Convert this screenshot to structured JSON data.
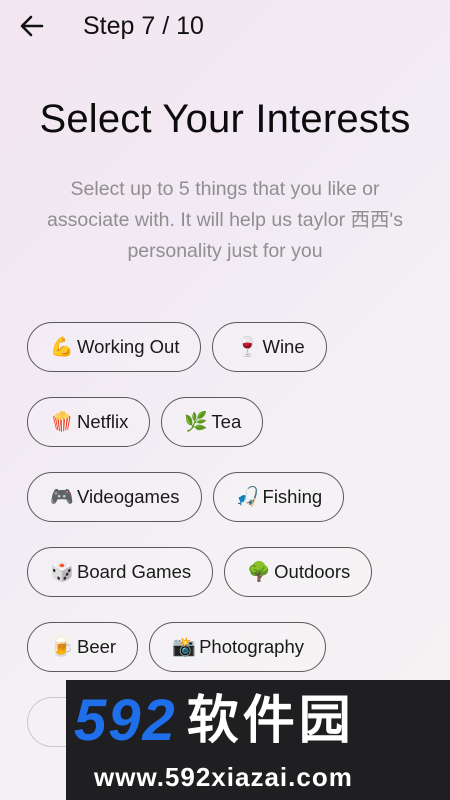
{
  "header": {
    "back_icon": "arrow-left-icon",
    "step": "Step 7 / 10"
  },
  "title": "Select Your Interests",
  "subtitle": "Select up to 5 things that you like or associate with. It will help us taylor 西西's personality just for you",
  "interests": [
    [
      {
        "emoji": "💪",
        "icon": "flexed-biceps-icon",
        "label": "Working Out"
      },
      {
        "emoji": "🍷",
        "icon": "wine-glass-icon",
        "label": "Wine"
      }
    ],
    [
      {
        "emoji": "🍿",
        "icon": "popcorn-icon",
        "label": "Netflix"
      },
      {
        "emoji": "🌿",
        "icon": "herb-leaf-icon",
        "label": "Tea"
      }
    ],
    [
      {
        "emoji": "🎮",
        "icon": "game-controller-icon",
        "label": "Videogames"
      },
      {
        "emoji": "🎣",
        "icon": "fishing-rod-icon",
        "label": "Fishing"
      }
    ],
    [
      {
        "emoji": "🎲",
        "icon": "dice-icon",
        "label": "Board Games"
      },
      {
        "emoji": "🌳",
        "icon": "tree-icon",
        "label": "Outdoors"
      }
    ],
    [
      {
        "emoji": "🍺",
        "icon": "beer-mug-icon",
        "label": "Beer"
      },
      {
        "emoji": "📸",
        "icon": "camera-flash-icon",
        "label": "Photography"
      }
    ]
  ],
  "watermark": {
    "number": "592",
    "cn_text": "软件园",
    "url": "www.592xiazai.com"
  }
}
